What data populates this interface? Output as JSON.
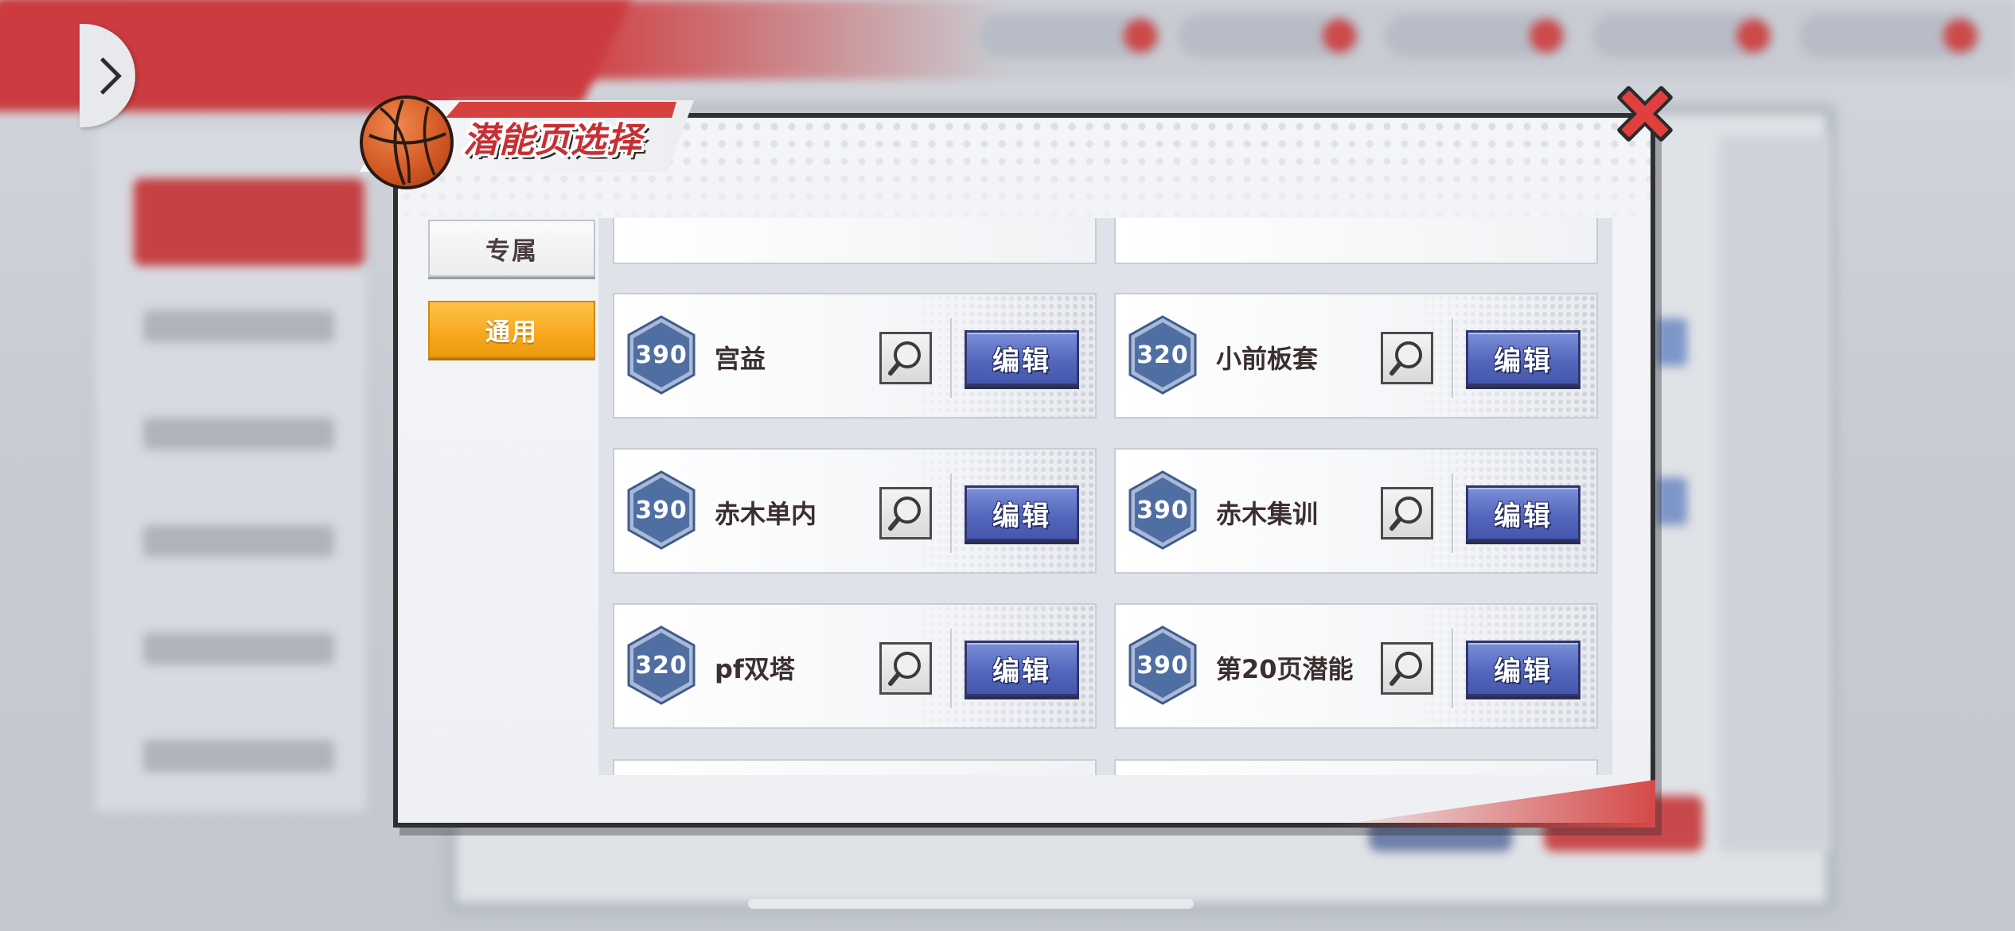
{
  "dialog": {
    "title": "潜能页选择",
    "close_icon": "close-x-icon"
  },
  "tabs": [
    {
      "label": "专属",
      "selected": false
    },
    {
      "label": "通用",
      "selected": true
    }
  ],
  "potential_pages": [
    {
      "value": "390",
      "name": "宫益",
      "edit_label": "编辑"
    },
    {
      "value": "320",
      "name": "小前板套",
      "edit_label": "编辑"
    },
    {
      "value": "390",
      "name": "赤木单内",
      "edit_label": "编辑"
    },
    {
      "value": "390",
      "name": "赤木集训",
      "edit_label": "编辑"
    },
    {
      "value": "320",
      "name": "pf双塔",
      "edit_label": "编辑"
    },
    {
      "value": "390",
      "name": "第20页潜能",
      "edit_label": "编辑"
    }
  ],
  "icons": {
    "hex_badge": "hexagon-icon",
    "preview": "magnifier-icon",
    "side_arrow": "chevron-right-icon",
    "ball": "basketball-icon"
  },
  "colors": {
    "accent_red": "#d6403f",
    "tab_selected": "#f6a81e",
    "edit_button": "#5467bd",
    "hex_badge": "#4f6fa3"
  }
}
